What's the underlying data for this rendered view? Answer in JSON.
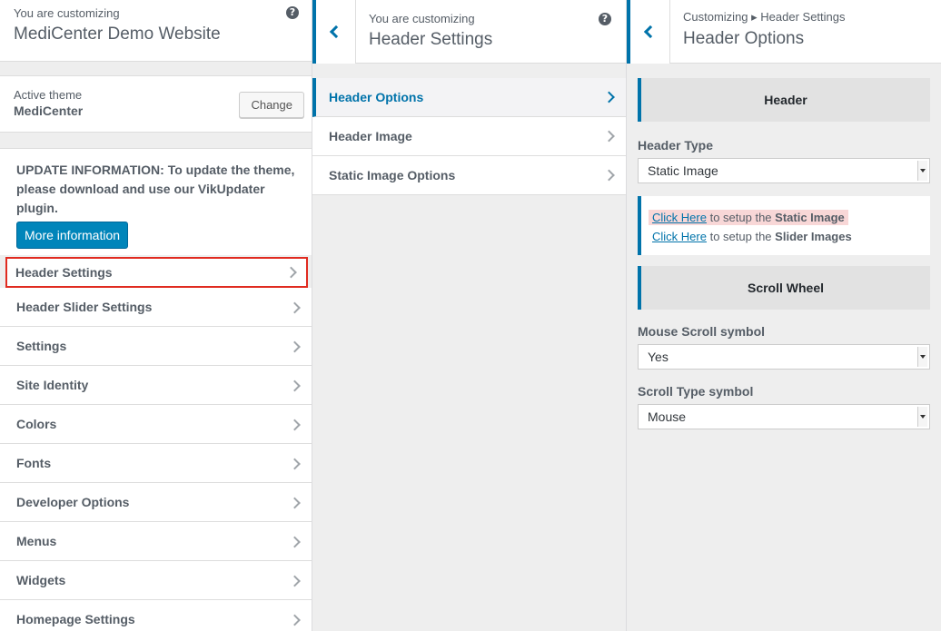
{
  "panel1": {
    "header_small": "You are customizing",
    "header_title": "MediCenter Demo Website",
    "help_icon": "?",
    "active_theme_label": "Active theme",
    "active_theme_name": "MediCenter",
    "change_button": "Change",
    "update_text": "UPDATE INFORMATION: To update the theme, please download and use our VikUpdater plugin.",
    "more_info_button": "More information",
    "menu_items": [
      {
        "label": "Header Settings"
      },
      {
        "label": "Header Slider Settings"
      },
      {
        "label": "Settings"
      },
      {
        "label": "Site Identity"
      },
      {
        "label": "Colors"
      },
      {
        "label": "Fonts"
      },
      {
        "label": "Developer Options"
      },
      {
        "label": "Menus"
      },
      {
        "label": "Widgets"
      },
      {
        "label": "Homepage Settings"
      }
    ]
  },
  "panel2": {
    "header_small": "You are customizing",
    "header_title": "Header Settings",
    "help_icon": "?",
    "items": [
      {
        "label": "Header Options"
      },
      {
        "label": "Header Image"
      },
      {
        "label": "Static Image Options"
      }
    ]
  },
  "panel3": {
    "breadcrumb": "Customizing ▸ Header Settings",
    "header_title": "Header Options",
    "section_header": "Header",
    "header_type_label": "Header Type",
    "header_type_value": "Static Image",
    "info_line1_link": "Click Here",
    "info_line1_mid": "to setup the",
    "info_line1_bold": "Static Image",
    "info_line2_link": "Click Here",
    "info_line2_mid": "to setup the",
    "info_line2_bold": "Slider Images",
    "section_scroll": "Scroll Wheel",
    "mouse_scroll_label": "Mouse Scroll symbol",
    "mouse_scroll_value": "Yes",
    "scroll_type_label": "Scroll Type symbol",
    "scroll_type_value": "Mouse"
  },
  "colors": {
    "accent": "#0073aa",
    "button_blue": "#0085ba",
    "highlight_border": "#e02b20",
    "highlight_bg": "#f8d7d7"
  }
}
